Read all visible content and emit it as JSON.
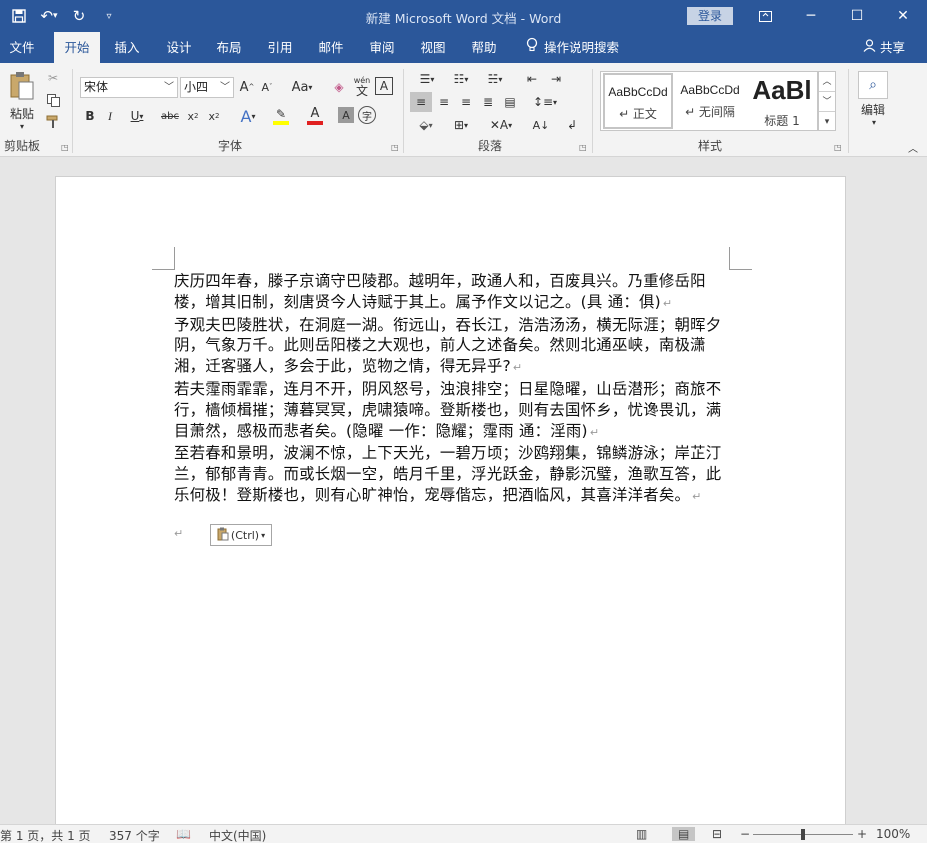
{
  "titlebar": {
    "title": "新建 Microsoft Word 文档  -  Word",
    "login": "登录"
  },
  "tabs": [
    {
      "label": "文件"
    },
    {
      "label": "开始"
    },
    {
      "label": "插入"
    },
    {
      "label": "设计"
    },
    {
      "label": "布局"
    },
    {
      "label": "引用"
    },
    {
      "label": "邮件"
    },
    {
      "label": "审阅"
    },
    {
      "label": "视图"
    },
    {
      "label": "帮助"
    }
  ],
  "tellme": "操作说明搜索",
  "share": "共享",
  "ribbon": {
    "clipboard": {
      "paste": "粘贴",
      "label": "剪贴板"
    },
    "font": {
      "name": "宋体",
      "size": "小四",
      "label": "字体",
      "case": "Aa",
      "wen": "wén",
      "phonetic": "文"
    },
    "paragraph": {
      "label": "段落"
    },
    "styles": {
      "label": "样式",
      "items": [
        {
          "preview": "AaBbCcDd",
          "name": "↵ 正文"
        },
        {
          "preview": "AaBbCcDd",
          "name": "↵ 无间隔"
        },
        {
          "preview": "AaBl",
          "name": "标题 1"
        }
      ]
    },
    "editing": {
      "label": "编辑"
    }
  },
  "document": {
    "paragraphs": [
      "庆历四年春，滕子京谪守巴陵郡。越明年，政通人和，百废具兴。乃重修岳阳楼，增其旧制，刻唐贤今人诗赋于其上。属予作文以记之。(具  通：俱)",
      "予观夫巴陵胜状，在洞庭一湖。衔远山，吞长江，浩浩汤汤，横无际涯；朝晖夕阴，气象万千。此则岳阳楼之大观也，前人之述备矣。然则北通巫峡，南极潇湘，迁客骚人，多会于此，览物之情，得无异乎?",
      "若夫霪雨霏霏，连月不开，阴风怒号，浊浪排空；日星隐曜，山岳潜形；商旅不行，樯倾楫摧；薄暮冥冥，虎啸猿啼。登斯楼也，则有去国怀乡，忧谗畏讥，满目萧然，感极而悲者矣。(隐曜  一作：隐耀；霪雨  通：淫雨)",
      "至若春和景明，波澜不惊，上下天光，一碧万顷；沙鸥翔集，锦鳞游泳；岸芷汀兰，郁郁青青。而或长烟一空，皓月千里，浮光跃金，静影沉璧，渔歌互答，此乐何极！登斯楼也，则有心旷神怡，宠辱偕忘，把酒临风，其喜洋洋者矣。"
    ],
    "paste_options": "(Ctrl)"
  },
  "statusbar": {
    "page": "第 1 页，共 1 页",
    "words": "357 个字",
    "language": "中文(中国)",
    "zoom": "100%",
    "zoom_level": 1.0
  }
}
